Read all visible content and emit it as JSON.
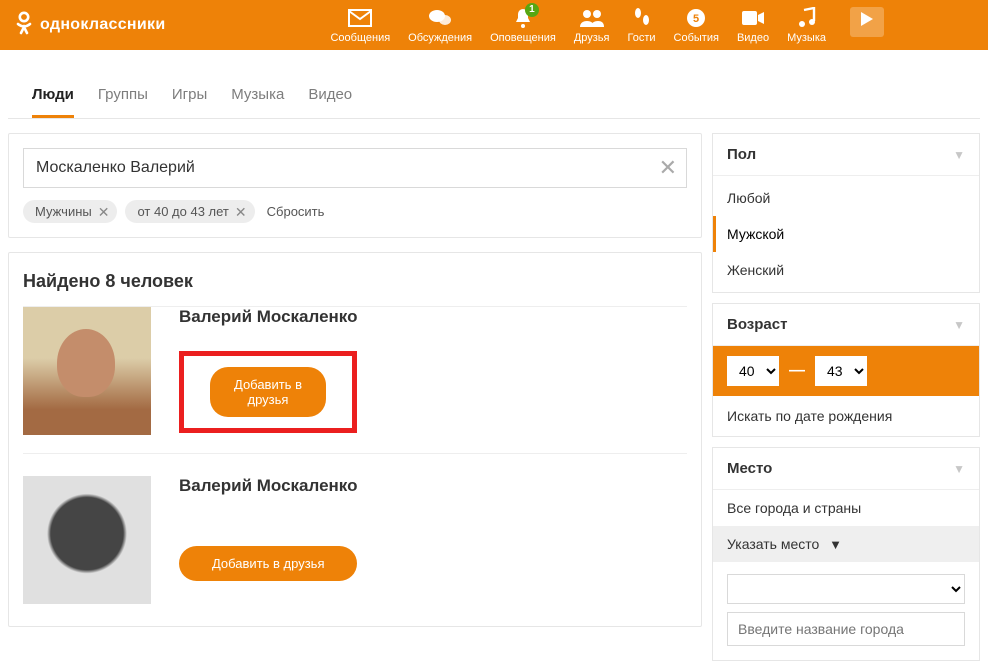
{
  "brand": "одноклассники",
  "nav": [
    {
      "id": "messages",
      "label": "Сообщения",
      "icon": "mail-icon"
    },
    {
      "id": "discuss",
      "label": "Обсуждения",
      "icon": "chat-icon"
    },
    {
      "id": "notif",
      "label": "Оповещения",
      "icon": "bell-icon",
      "badge": "1"
    },
    {
      "id": "friends",
      "label": "Друзья",
      "icon": "friends-icon"
    },
    {
      "id": "guests",
      "label": "Гости",
      "icon": "footsteps-icon"
    },
    {
      "id": "events",
      "label": "События",
      "icon": "events-icon"
    },
    {
      "id": "video",
      "label": "Видео",
      "icon": "camera-icon"
    },
    {
      "id": "music",
      "label": "Музыка",
      "icon": "music-icon"
    }
  ],
  "tabs": [
    "Люди",
    "Группы",
    "Игры",
    "Музыка",
    "Видео"
  ],
  "active_tab": 0,
  "search": {
    "query": "Москаленко Валерий",
    "chips": [
      "Мужчины",
      "от 40 до 43 лет"
    ],
    "reset": "Сбросить"
  },
  "results": {
    "title": "Найдено 8 человек",
    "add_label": "Добавить в друзья",
    "items": [
      {
        "name": "Валерий Москаленко",
        "highlighted": true
      },
      {
        "name": "Валерий Москаленко",
        "highlighted": false
      }
    ]
  },
  "filters": {
    "gender": {
      "title": "Пол",
      "options": [
        "Любой",
        "Мужской",
        "Женский"
      ],
      "selected": 1
    },
    "age": {
      "title": "Возраст",
      "from": "40",
      "to": "43",
      "by_birth": "Искать по дате рождения"
    },
    "place": {
      "title": "Место",
      "all": "Все города и страны",
      "pick": "Указать место",
      "city_placeholder": "Введите название города"
    }
  }
}
